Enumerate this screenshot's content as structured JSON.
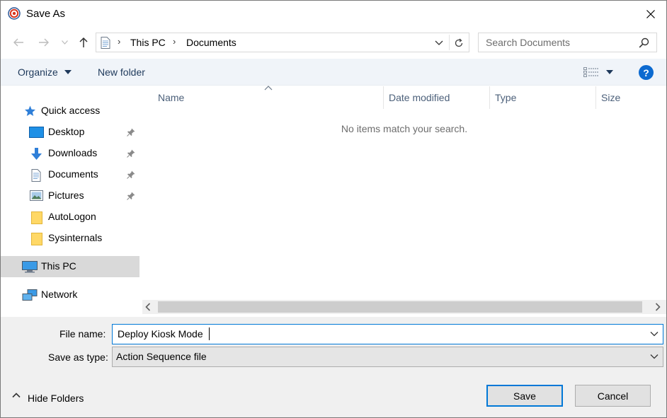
{
  "window": {
    "title": "Save As",
    "app_icon": "target-icon",
    "close_icon": "close-icon"
  },
  "navigation": {
    "back_icon": "arrow-left-icon",
    "forward_icon": "arrow-right-icon",
    "recent_icon": "chevron-down-icon",
    "up_icon": "arrow-up-icon"
  },
  "address": {
    "breadcrumbs": [
      "This PC",
      "Documents"
    ],
    "refresh_icon": "refresh-icon"
  },
  "search": {
    "placeholder": "Search Documents",
    "icon": "search-icon"
  },
  "toolbar": {
    "organize_label": "Organize",
    "new_folder_label": "New folder",
    "view_icon": "details-view-icon",
    "help_label": "?"
  },
  "nav_pane": {
    "items": [
      {
        "label": "Quick access",
        "icon": "star-icon"
      },
      {
        "label": "Desktop",
        "icon": "desktop-icon",
        "pinned": true
      },
      {
        "label": "Downloads",
        "icon": "download-icon",
        "pinned": true
      },
      {
        "label": "Documents",
        "icon": "document-icon",
        "pinned": true
      },
      {
        "label": "Pictures",
        "icon": "pictures-icon",
        "pinned": true
      },
      {
        "label": "AutoLogon",
        "icon": "folder-icon"
      },
      {
        "label": "Sysinternals",
        "icon": "folder-icon"
      },
      {
        "label": "This PC",
        "icon": "computer-icon",
        "selected": true
      },
      {
        "label": "Network",
        "icon": "network-icon"
      }
    ]
  },
  "file_list": {
    "columns": [
      "Name",
      "Date modified",
      "Type",
      "Size"
    ],
    "empty_message": "No items match your search."
  },
  "form": {
    "file_name_label": "File name:",
    "file_name_value": "Deploy Kiosk Mode",
    "save_as_type_label": "Save as type:",
    "save_as_type_value": "Action Sequence file"
  },
  "footer": {
    "hide_folders_label": "Hide Folders",
    "save_label": "Save",
    "cancel_label": "Cancel"
  },
  "colors": {
    "accent": "#0078d7",
    "toolbar_bg": "#f0f4f9",
    "link_text": "#1e395b",
    "selected_bg": "#d9d9d9"
  }
}
